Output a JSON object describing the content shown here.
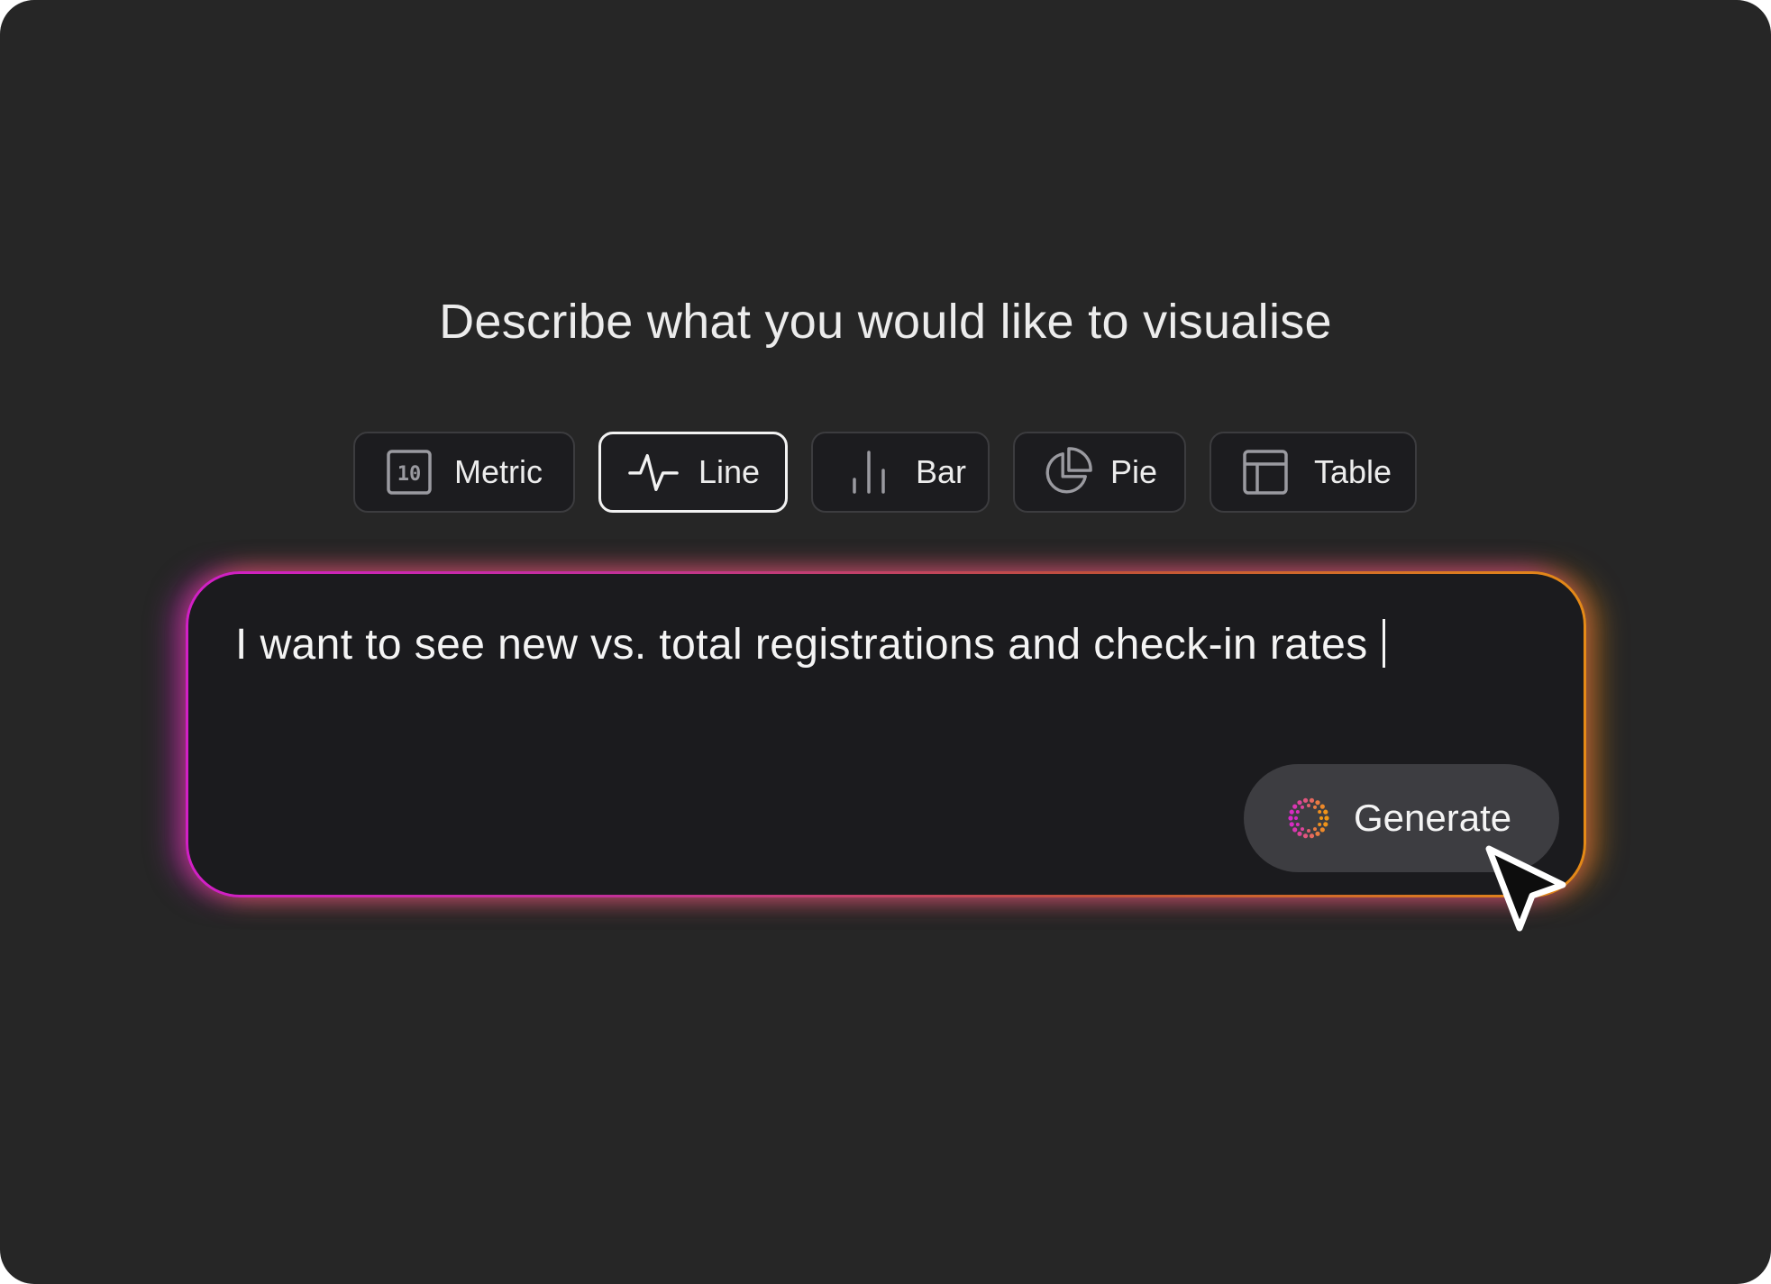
{
  "heading": "Describe what you would like to visualise",
  "chart_types": [
    {
      "label": "Metric",
      "icon": "metric-10-icon",
      "icon_text": "10",
      "active": false
    },
    {
      "label": "Line",
      "icon": "line-chart-icon",
      "active": true
    },
    {
      "label": "Bar",
      "icon": "bar-chart-icon",
      "active": false
    },
    {
      "label": "Pie",
      "icon": "pie-chart-icon",
      "active": false
    },
    {
      "label": "Table",
      "icon": "table-icon",
      "active": false
    }
  ],
  "prompt": {
    "value": "I want to see new vs. total registrations and check-in rates"
  },
  "generate_button": {
    "label": "Generate",
    "icon": "sparkle-ring-icon"
  },
  "colors": {
    "background": "#262626",
    "input_background": "#1b1b1e",
    "glow_start": "#d21fc6",
    "glow_end": "#e58a17",
    "button_background": "#3d3d41"
  }
}
